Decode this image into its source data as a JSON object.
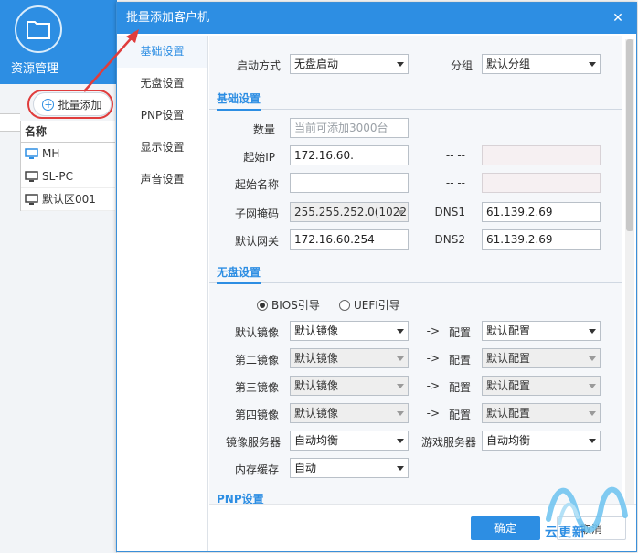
{
  "background_app": {
    "title": "资源管理",
    "add_button_label": "批量添加",
    "list_header": "名称",
    "items": [
      "MH",
      "SL-PC",
      "默认区001"
    ]
  },
  "dialog": {
    "title": "批量添加客户机",
    "close_glyph": "✕",
    "nav": [
      "基础设置",
      "无盘设置",
      "PNP设置",
      "显示设置",
      "声音设置"
    ],
    "active_nav": "基础设置",
    "top": {
      "boot_mode_label": "启动方式",
      "boot_mode_value": "无盘启动",
      "group_label": "分组",
      "group_value": "默认分组"
    },
    "basic": {
      "section_title": "基础设置",
      "count_label": "数量",
      "count_placeholder": "当前可添加3000台",
      "start_ip_label": "起始IP",
      "start_ip_value": "172.16.60.",
      "start_name_label": "起始名称",
      "start_name_value": "",
      "range_sep": "-- --",
      "subnet_label": "子网掩码",
      "subnet_value": "255.255.252.0(1022",
      "gateway_label": "默认网关",
      "gateway_value": "172.16.60.254",
      "dns1_label": "DNS1",
      "dns1_value": "61.139.2.69",
      "dns2_label": "DNS2",
      "dns2_value": "61.139.2.69"
    },
    "diskless": {
      "section_title": "无盘设置",
      "bios_label": "BIOS引导",
      "uefi_label": "UEFI引导",
      "selected_boot": "BIOS",
      "rows": [
        {
          "label": "默认镜像",
          "image": "默认镜像",
          "arrow": "->",
          "config_label": "配置",
          "config": "默认配置"
        },
        {
          "label": "第二镜像",
          "image": "默认镜像",
          "arrow": "->",
          "config_label": "配置",
          "config": "默认配置"
        },
        {
          "label": "第三镜像",
          "image": "默认镜像",
          "arrow": "->",
          "config_label": "配置",
          "config": "默认配置"
        },
        {
          "label": "第四镜像",
          "image": "默认镜像",
          "arrow": "->",
          "config_label": "配置",
          "config": "默认配置"
        }
      ],
      "image_server_label": "镜像服务器",
      "image_server_value": "自动均衡",
      "game_server_label": "游戏服务器",
      "game_server_value": "自动均衡",
      "cache_label": "内存缓存",
      "cache_value": "自动"
    },
    "pnp": {
      "section_title": "PNP设置"
    },
    "footer": {
      "ok_label": "确定",
      "cancel_label": "取消"
    }
  },
  "watermark": {
    "text": "云更新"
  },
  "colors": {
    "accent": "#2d8ee3",
    "annotation": "#e03c3c"
  }
}
